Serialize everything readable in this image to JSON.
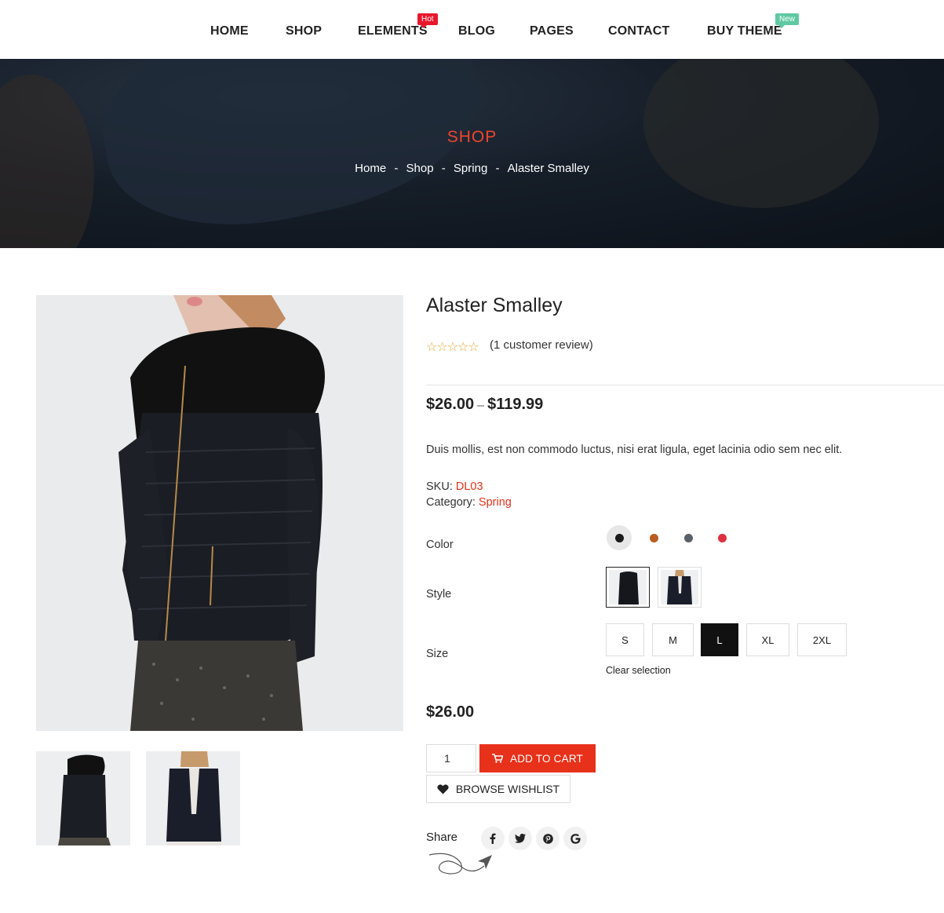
{
  "nav": {
    "items": [
      "HOME",
      "SHOP",
      "ELEMENTS",
      "BLOG",
      "PAGES",
      "CONTACT",
      "BUY THEME"
    ],
    "badges": {
      "hot": "Hot",
      "new": "New"
    }
  },
  "hero": {
    "title": "SHOP",
    "breadcrumb": [
      "Home",
      "Shop",
      "Spring",
      "Alaster Smalley"
    ],
    "separator": "-"
  },
  "product": {
    "title": "Alaster Smalley",
    "rating": 0,
    "stars": "☆☆☆☆☆",
    "reviews": "(1 customer review)",
    "price_min": "$26.00",
    "price_sep": "–",
    "price_max": "$119.99",
    "description": "Duis mollis, est non commodo luctus, nisi erat ligula, eget lacinia odio sem nec elit.",
    "sku_label": "SKU:",
    "sku": "DL03",
    "category_label": "Category:",
    "category": "Spring",
    "color_label": "Color",
    "colors": [
      "#1a1a1a",
      "#b85c22",
      "#596068",
      "#e0303e"
    ],
    "style_label": "Style",
    "size_label": "Size",
    "sizes": [
      "S",
      "M",
      "L",
      "XL",
      "2XL"
    ],
    "selected_size": "L",
    "clear": "Clear selection",
    "selected_price": "$26.00",
    "quantity": "1",
    "add_to_cart": "ADD TO CART",
    "wishlist": "BROWSE WISHLIST",
    "share_label": "Share",
    "share_icons": [
      "facebook-icon",
      "twitter-icon",
      "pinterest-icon",
      "google-icon"
    ]
  },
  "colors": {
    "accent": "#e8311a",
    "hot": "#e8172c",
    "new": "#5fc9a3"
  }
}
